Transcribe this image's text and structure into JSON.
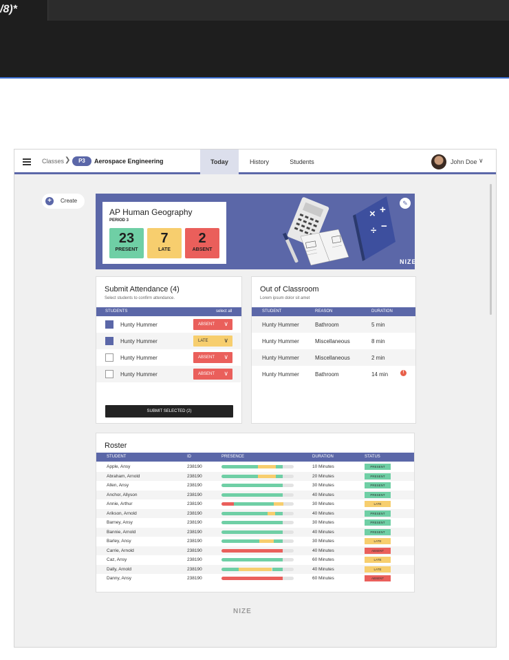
{
  "editor": {
    "tab_label": "/8)*"
  },
  "nav": {
    "breadcrumb_root": "Classes",
    "period_badge": "P3",
    "course": "Aerospace Engineering",
    "tabs": [
      "Today",
      "History",
      "Students"
    ],
    "active_tab": "Today",
    "user_name": "John Doe"
  },
  "create_label": "Create",
  "summary": {
    "title": "AP Human Geography",
    "period": "PERIOD 3",
    "stats": [
      {
        "count": "23",
        "label": "PRESENT",
        "color": "#6fcfa5"
      },
      {
        "count": "7",
        "label": "LATE",
        "color": "#f7ce6e"
      },
      {
        "count": "2",
        "label": "ABSENT",
        "color": "#ea5f5b"
      }
    ],
    "brand": "NIZE"
  },
  "submit_attendance": {
    "title": "Submit Attendance (4)",
    "subtitle": "Select students to confirm attendance.",
    "col_students": "STUDENTS",
    "select_all": "select all",
    "rows": [
      {
        "name": "Hunty Hummer",
        "status": "ABSENT",
        "checked": true
      },
      {
        "name": "Hunty Hummer",
        "status": "LATE",
        "checked": true
      },
      {
        "name": "Hunty Hummer",
        "status": "ABSENT",
        "checked": false
      },
      {
        "name": "Hunty Hummer",
        "status": "ABSENT",
        "checked": false
      }
    ],
    "submit_label": "SUBMIT SELECTED (2)"
  },
  "out_of_classroom": {
    "title": "Out of Classroom",
    "subtitle": "Lorem ipsum dolor sit amet",
    "columns": [
      "STUDENT",
      "REASON",
      "DURATION"
    ],
    "rows": [
      {
        "student": "Hunty Hummer",
        "reason": "Bathroom",
        "duration": "5 min",
        "alert": false
      },
      {
        "student": "Hunty Hummer",
        "reason": "Miscellaneous",
        "duration": "8 min",
        "alert": false
      },
      {
        "student": "Hunty Hummer",
        "reason": "Miscellaneous",
        "duration": "2 min",
        "alert": false
      },
      {
        "student": "Hunty Hummer",
        "reason": "Bathroom",
        "duration": "14 min",
        "alert": true
      }
    ]
  },
  "roster": {
    "title": "Roster",
    "columns": [
      "STUDENT",
      "ID",
      "PRESENCE",
      "DURATION",
      "STATUS"
    ],
    "status_colors": {
      "PRESENT": "#6fcfa5",
      "LATE": "#f7ce6e",
      "ABSENT": "#ea5f5b"
    },
    "rows": [
      {
        "student": "Apple, Ansy",
        "id": "238190",
        "presence": [
          [
            "g",
            0.5
          ],
          [
            "y",
            0.25
          ],
          [
            "g",
            0.1
          ]
        ],
        "duration": "10 Minutes",
        "status": "PRESENT"
      },
      {
        "student": "Abraham, Arnold",
        "id": "238190",
        "presence": [
          [
            "g",
            0.5
          ],
          [
            "y",
            0.25
          ],
          [
            "g",
            0.1
          ]
        ],
        "duration": "20 Minutes",
        "status": "PRESENT"
      },
      {
        "student": "Allen, Ansy",
        "id": "238190",
        "presence": [
          [
            "g",
            0.85
          ]
        ],
        "duration": "30 Minutes",
        "status": "PRESENT"
      },
      {
        "student": "Anchor, Allyson",
        "id": "238190",
        "presence": [
          [
            "g",
            0.85
          ]
        ],
        "duration": "40 Minutes",
        "status": "PRESENT"
      },
      {
        "student": "Annie, Arthur",
        "id": "238190",
        "presence": [
          [
            "r",
            0.17
          ],
          [
            "g",
            0.55
          ],
          [
            "y",
            0.14
          ]
        ],
        "duration": "30 Minutes",
        "status": "LATE"
      },
      {
        "student": "Arikson, Arnold",
        "id": "238190",
        "presence": [
          [
            "g",
            0.64
          ],
          [
            "y",
            0.1
          ],
          [
            "g",
            0.11
          ]
        ],
        "duration": "40 Minutes",
        "status": "PRESENT"
      },
      {
        "student": "Barney, Ansy",
        "id": "238190",
        "presence": [
          [
            "g",
            0.85
          ]
        ],
        "duration": "30 Minutes",
        "status": "PRESENT"
      },
      {
        "student": "Bannie, Arnold",
        "id": "238190",
        "presence": [
          [
            "g",
            0.85
          ]
        ],
        "duration": "40 Minutes",
        "status": "PRESENT"
      },
      {
        "student": "Barley, Ansy",
        "id": "238190",
        "presence": [
          [
            "g",
            0.52
          ],
          [
            "y",
            0.2
          ],
          [
            "g",
            0.13
          ]
        ],
        "duration": "30 Minutes",
        "status": "LATE"
      },
      {
        "student": "Carrie, Arnold",
        "id": "238190",
        "presence": [
          [
            "r",
            0.85
          ]
        ],
        "duration": "40 Minutes",
        "status": "ABSENT"
      },
      {
        "student": "Caz, Ansy",
        "id": "238190",
        "presence": [
          [
            "g",
            0.85
          ]
        ],
        "duration": "60 Minutes",
        "status": "LATE"
      },
      {
        "student": "Dally, Arnold",
        "id": "238190",
        "presence": [
          [
            "g",
            0.24
          ],
          [
            "y",
            0.46
          ],
          [
            "g",
            0.15
          ]
        ],
        "duration": "40 Minutes",
        "status": "LATE"
      },
      {
        "student": "Danny, Ansy",
        "id": "238190",
        "presence": [
          [
            "r",
            0.85
          ]
        ],
        "duration": "60 Minutes",
        "status": "ABSENT"
      }
    ]
  },
  "footer_brand": "NIZE"
}
